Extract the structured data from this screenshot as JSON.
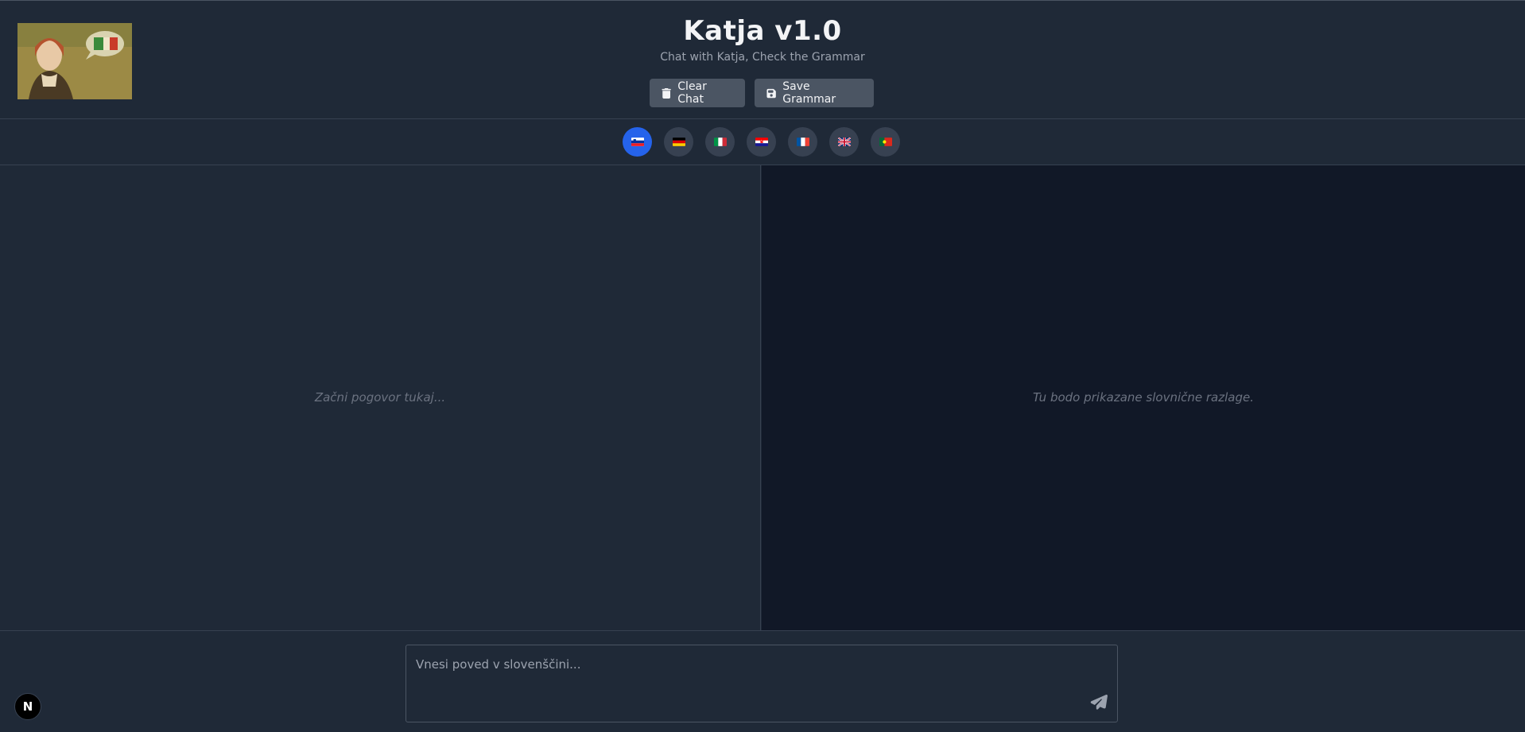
{
  "header": {
    "title": "Katja v1.0",
    "subtitle": "Chat with Katja, Check the Grammar",
    "clear_label": "Clear Chat",
    "save_label": "Save Grammar",
    "logo_icon": "portrait-logo"
  },
  "languages": [
    {
      "code": "sl",
      "name": "slovenian-flag",
      "active": true
    },
    {
      "code": "de",
      "name": "german-flag",
      "active": false
    },
    {
      "code": "it",
      "name": "italian-flag",
      "active": false
    },
    {
      "code": "hr",
      "name": "croatian-flag",
      "active": false
    },
    {
      "code": "fr",
      "name": "french-flag",
      "active": false
    },
    {
      "code": "gb",
      "name": "uk-flag",
      "active": false
    },
    {
      "code": "pt",
      "name": "portuguese-flag",
      "active": false
    }
  ],
  "chat": {
    "placeholder": "Začni pogovor tukaj..."
  },
  "grammar": {
    "placeholder": "Tu bodo prikazane slovnične razlage."
  },
  "composer": {
    "placeholder": "Vnesi poved v slovenščini..."
  },
  "badge": {
    "letter": "N"
  },
  "colors": {
    "accent": "#2563eb",
    "background": "#1f2937",
    "panel_dark": "#111827"
  }
}
